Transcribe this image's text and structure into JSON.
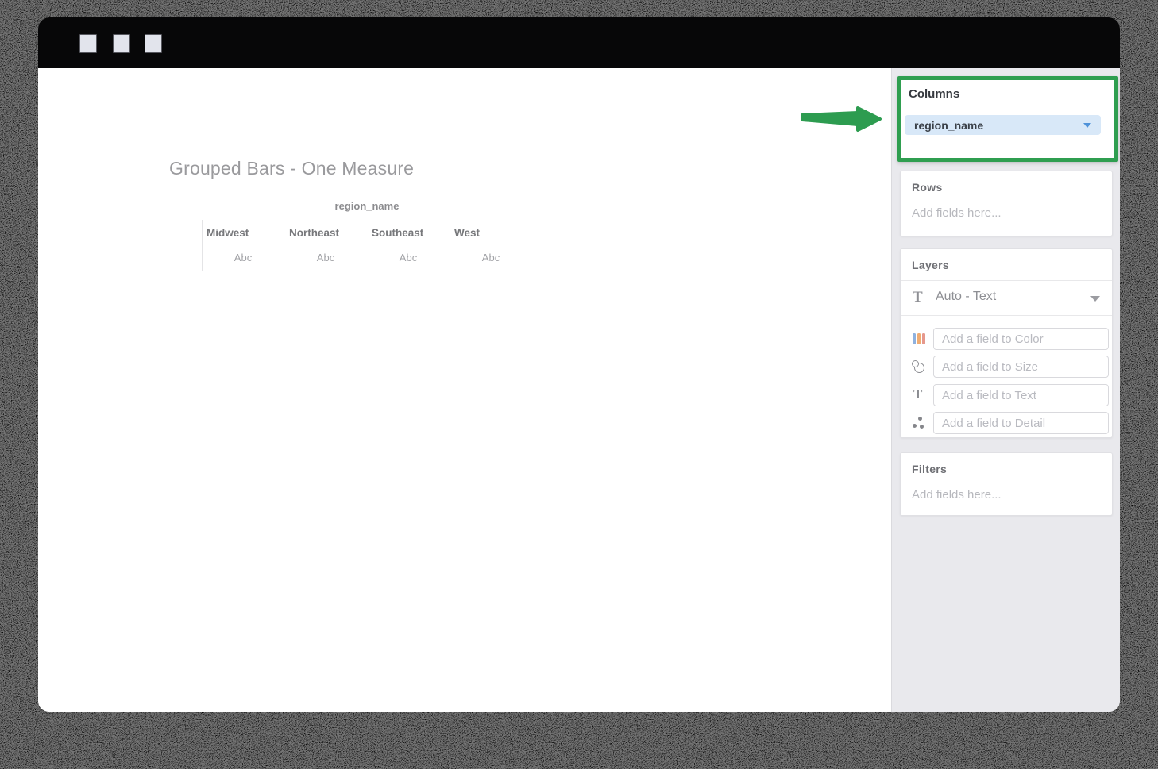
{
  "titlebar": {
    "controls": [
      "window-control-1",
      "window-control-2",
      "window-control-3"
    ]
  },
  "canvas": {
    "title": "Grouped Bars - One Measure",
    "table": {
      "group_header": "region_name",
      "columns": [
        "Midwest",
        "Northeast",
        "Southeast",
        "West"
      ],
      "cells": [
        "Abc",
        "Abc",
        "Abc",
        "Abc"
      ]
    }
  },
  "sidebar": {
    "columns_panel": {
      "label": "Columns",
      "pill_value": "region_name",
      "highlighted": true
    },
    "rows_panel": {
      "label": "Rows",
      "placeholder": "Add fields here..."
    },
    "layers_panel": {
      "label": "Layers",
      "layer_selector": {
        "value": "Auto - Text",
        "icon": "text-icon"
      },
      "fields": [
        {
          "icon": "color-bars-icon",
          "placeholder": "Add a field to Color"
        },
        {
          "icon": "size-circles-icon",
          "placeholder": "Add a field to Size"
        },
        {
          "icon": "text-icon",
          "placeholder": "Add a field to Text"
        },
        {
          "icon": "detail-dots-icon",
          "placeholder": "Add a field to Detail"
        }
      ]
    },
    "filters_panel": {
      "label": "Filters",
      "placeholder": "Add fields here..."
    }
  },
  "annotation": {
    "arrow": "green arrow pointing to Columns panel"
  },
  "colors": {
    "highlight_green": "#2f9e50",
    "pill_background": "#d8e8f8",
    "pill_caret_blue": "#4e92d9",
    "sidebar_background": "#e9e9ed",
    "titlebar_black": "#070708",
    "color_icon_bars": [
      "#8fb1de",
      "#f0ac72",
      "#e6988c"
    ]
  }
}
